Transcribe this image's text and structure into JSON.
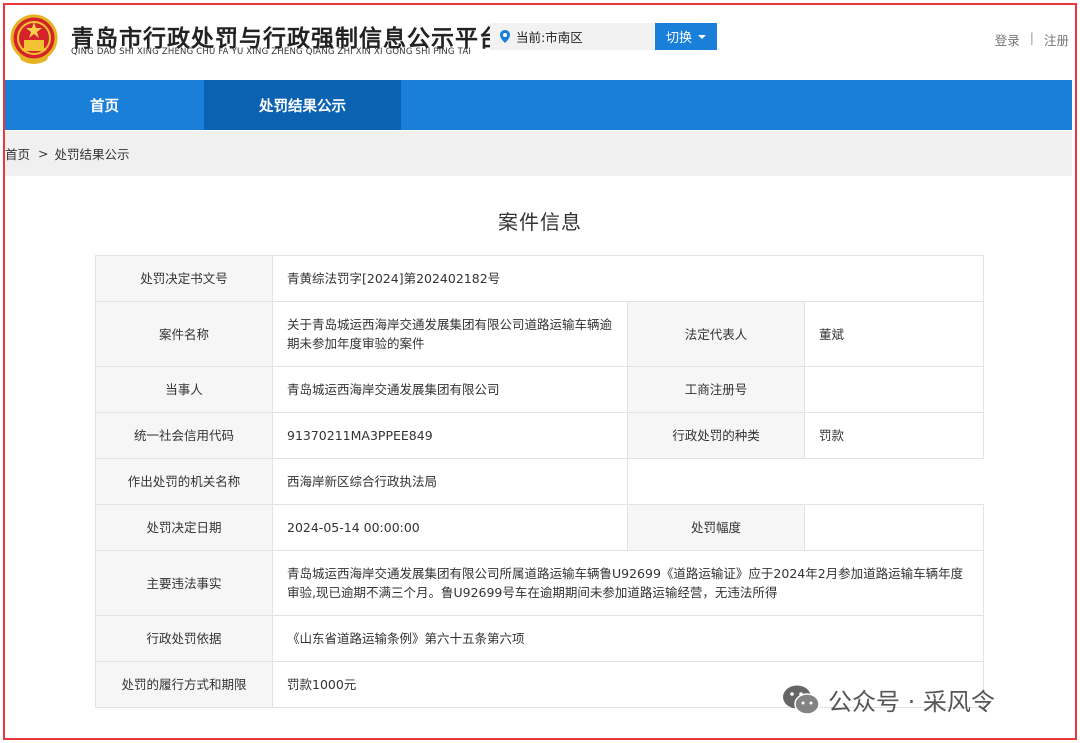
{
  "header": {
    "title": "青岛市行政处罚与行政强制信息公示平台",
    "title_pinyin": "QING DAO SHI XING ZHENG CHU FA YU XING ZHENG QIANG ZHI XIN XI GONG SHI PING TAI",
    "location_label": "当前:市南区",
    "switch_label": "切换",
    "login": "登录",
    "separator": "|",
    "register": "注册"
  },
  "nav": {
    "home": "首页",
    "results": "处罚结果公示"
  },
  "breadcrumb": {
    "home": "首页",
    "arrow": ">",
    "current": "处罚结果公示"
  },
  "case": {
    "heading": "案件信息",
    "rows": [
      {
        "label": "处罚决定书文号",
        "value": "青黄综法罚字[2024]第202402182号"
      },
      {
        "label": "案件名称",
        "value": "关于青岛城运西海岸交通发展集团有限公司道路运输车辆逾期未参加年度审验的案件",
        "label2": "法定代表人",
        "value2": "董斌"
      },
      {
        "label": "当事人",
        "value": "青岛城运西海岸交通发展集团有限公司",
        "label2": "工商注册号",
        "value2": ""
      },
      {
        "label": "统一社会信用代码",
        "value": "91370211MA3PPEE849",
        "label2": "行政处罚的种类",
        "value2": "罚款"
      },
      {
        "label": "作出处罚的机关名称",
        "value": "西海岸新区综合行政执法局"
      },
      {
        "label": "处罚决定日期",
        "value": "2024-05-14 00:00:00",
        "label2": "处罚幅度",
        "value2": ""
      },
      {
        "label": "主要违法事实",
        "value": "青岛城运西海岸交通发展集团有限公司所属道路运输车辆鲁U92699《道路运输证》应于2024年2月参加道路运输车辆年度审验,现已逾期不满三个月。鲁U92699号车在逾期期间未参加道路运输经营，无违法所得"
      },
      {
        "label": "行政处罚依据",
        "value": "《山东省道路运输条例》第六十五条第六项"
      },
      {
        "label": "处罚的履行方式和期限",
        "value": "罚款1000元"
      }
    ]
  },
  "watermark": {
    "text": "公众号 · 采风令"
  },
  "colors": {
    "nav_blue": "#1a7fd8",
    "nav_active": "#0b62b1",
    "frame_red": "#e8383d"
  }
}
